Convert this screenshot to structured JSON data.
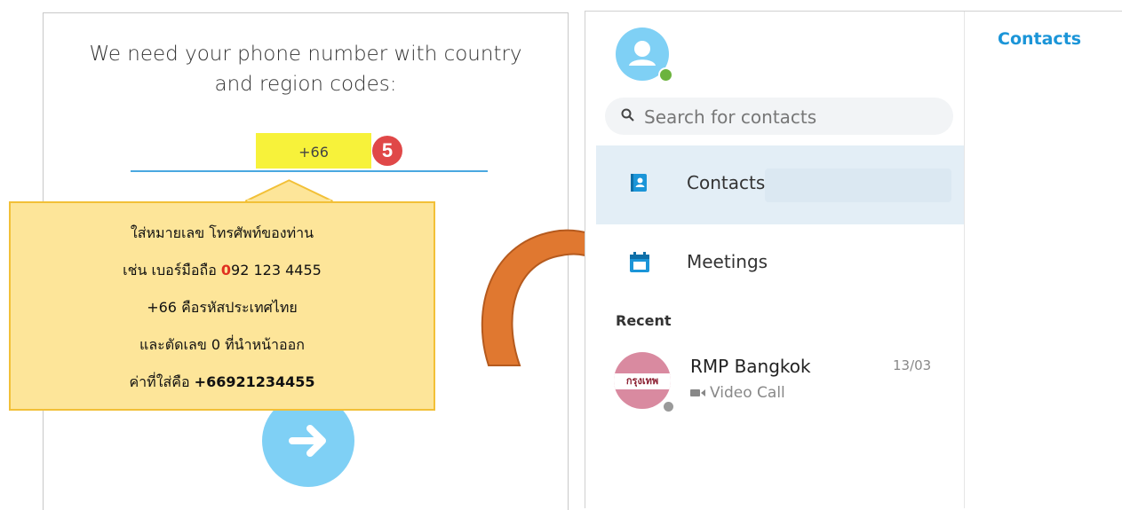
{
  "left": {
    "prompt_line1": "We need your phone number with country",
    "prompt_line2": "and region codes:",
    "phone_value": "+66",
    "step_badge": "5",
    "next_icon": "arrow-right-icon"
  },
  "callout": {
    "line1": "ใส่หมายเลข โทรศัพท์ของท่าน",
    "line2_prefix": "เช่น เบอร์มือถือ ",
    "line2_highlight": "0",
    "line2_suffix": "92 123 4455",
    "line3": "+66 คือรหัสประเทศไทย",
    "line4": "และตัดเลข 0 ที่นำหน้าออก",
    "line5_prefix": "ค่าที่ใส่คือ  ",
    "line5_value": "+66921234455"
  },
  "right": {
    "header_title": "Contacts",
    "search_placeholder": "Search for contacts",
    "nav": [
      {
        "label": "Contacts",
        "icon": "contacts-book-icon"
      },
      {
        "label": "Meetings",
        "icon": "calendar-icon"
      }
    ],
    "recent_header": "Recent",
    "recent": [
      {
        "name": "RMP Bangkok",
        "time": "13/03",
        "subtitle": "Video Call",
        "avatar_text": "กรุงเทพ"
      }
    ]
  },
  "colors": {
    "accent": "#1b95d8",
    "highlight": "#f7f23a",
    "badge": "#e04848",
    "callout_fill": "#fde599",
    "arrow": "#e07830"
  }
}
